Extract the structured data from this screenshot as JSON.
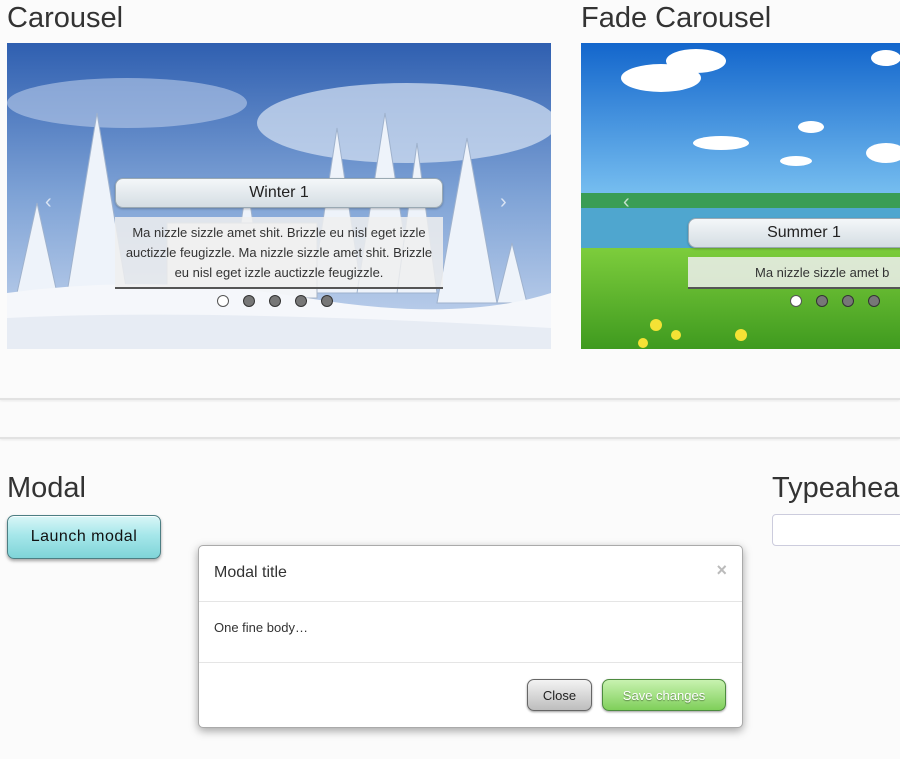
{
  "carousel": {
    "title": "Carousel",
    "caption_title": "Winter 1",
    "caption_text": "Ma nizzle sizzle amet shit. Brizzle eu nisl eget izzle auctizzle feugizzle. Ma nizzle sizzle amet shit. Brizzle eu nisl eget izzle auctizzle feugizzle.",
    "prev_icon": "‹",
    "next_icon": "›",
    "slide_count": 5,
    "active_slide": 1
  },
  "fade_carousel": {
    "title": "Fade Carousel",
    "caption_title": "Summer 1",
    "caption_text": "Ma nizzle sizzle amet b",
    "prev_icon": "‹",
    "slide_count": 4,
    "active_slide": 1
  },
  "modal_section": {
    "title": "Modal",
    "launch_label": "Launch modal"
  },
  "typeahead_section": {
    "title": "Typeahead"
  },
  "modal": {
    "title": "Modal title",
    "close_icon": "×",
    "body": "One fine body…",
    "close_label": "Close",
    "save_label": "Save changes"
  },
  "colors": {
    "launch_button": "#a6e7ea",
    "save_button": "#7fcf5a",
    "close_button": "#bdbdbd"
  }
}
